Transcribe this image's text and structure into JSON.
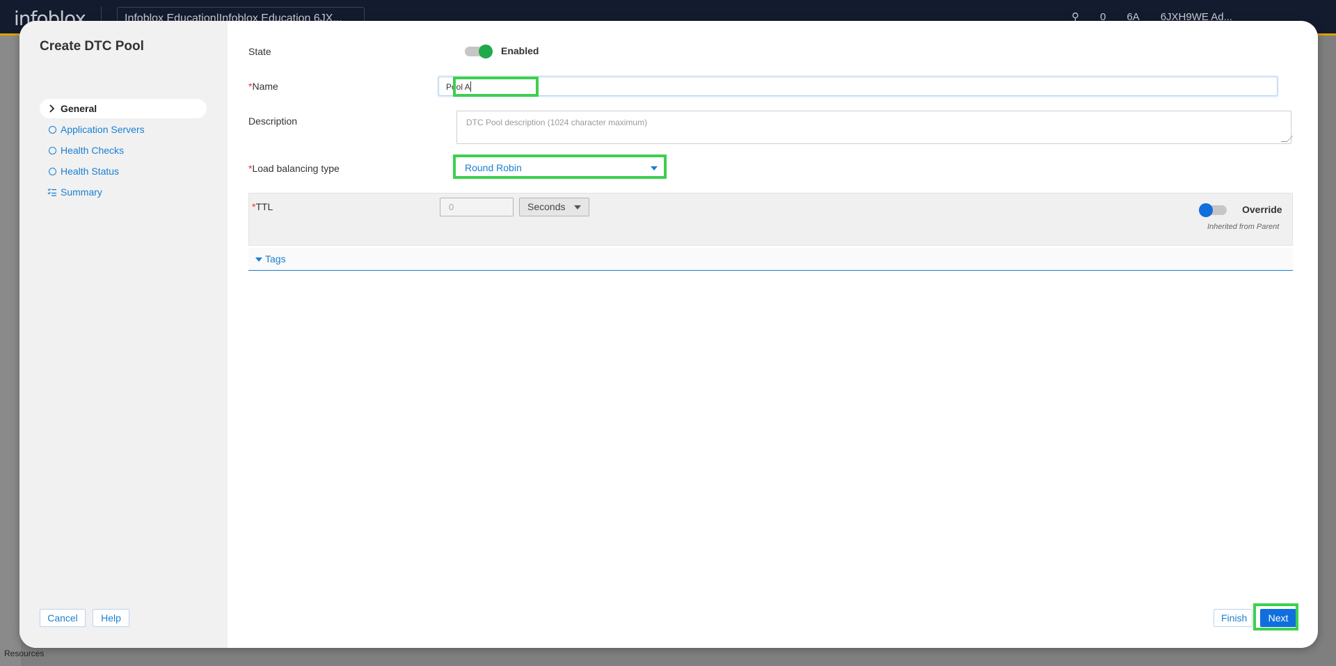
{
  "background": {
    "logo": "infoblox",
    "account_selector": "Infoblox Education|Infoblox Education 6JX...",
    "notification_count": "0",
    "user_initials": "6A",
    "user_label": "6JXH9WE Ad...",
    "sidebar_bottom_label": "Resources"
  },
  "dialog": {
    "title": "Create DTC Pool",
    "nav": [
      {
        "label": "General",
        "icon": "chevron-right-icon",
        "active": true
      },
      {
        "label": "Application Servers",
        "icon": "circle-icon",
        "active": false
      },
      {
        "label": "Health Checks",
        "icon": "circle-icon",
        "active": false
      },
      {
        "label": "Health Status",
        "icon": "circle-icon",
        "active": false
      },
      {
        "label": "Summary",
        "icon": "list-check-icon",
        "active": false
      }
    ],
    "cancel_label": "Cancel",
    "help_label": "Help",
    "finish_label": "Finish",
    "next_label": "Next"
  },
  "form": {
    "state_label": "State",
    "state_value": "Enabled",
    "name_label": "Name",
    "name_value": "Pool A",
    "description_label": "Description",
    "description_placeholder": "DTC Pool description (1024 character maximum)",
    "lb_label": "Load balancing type",
    "lb_value": "Round Robin",
    "ttl_label": "TTL",
    "ttl_value": "0",
    "ttl_unit": "Seconds",
    "override_label": "Override",
    "inherited_label": "Inherited from Parent",
    "tags_label": "Tags",
    "required_marker": "*"
  },
  "colors": {
    "accent": "#1a7fd1",
    "toggle_on": "#1fa94b",
    "highlight": "#3ecf4f",
    "primary_button": "#0f6fde"
  }
}
